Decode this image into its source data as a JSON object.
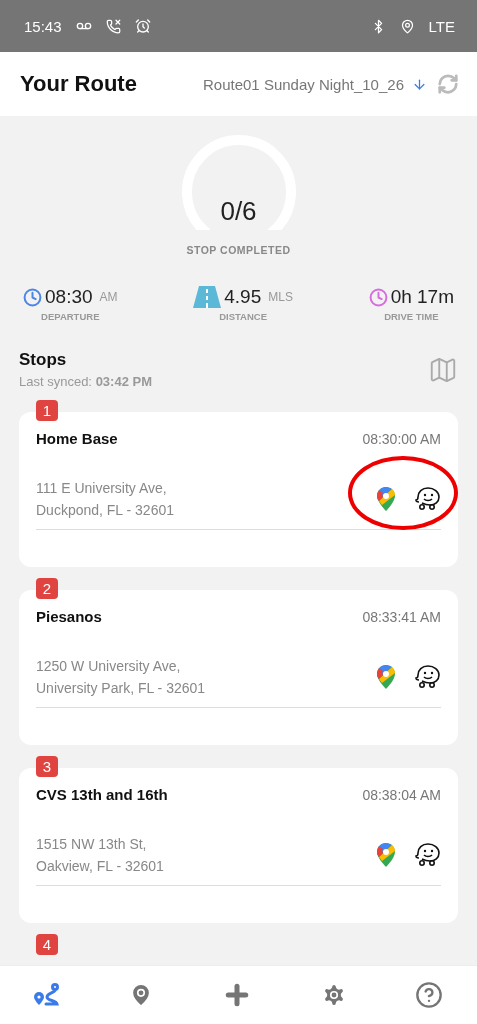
{
  "status_bar": {
    "time": "15:43",
    "network": "LTE"
  },
  "header": {
    "title": "Your Route",
    "route_name": "Route01 Sunday Night_10_26"
  },
  "progress": {
    "value": "0/6",
    "label": "STOP COMPLETED"
  },
  "stats": [
    {
      "kind": "clock",
      "value": "08:30",
      "unit": "AM",
      "label": "DEPARTURE",
      "color": "#4a86e8"
    },
    {
      "kind": "road",
      "value": "4.95",
      "unit": "MLS",
      "label": "DISTANCE",
      "color": "#5bb8d6"
    },
    {
      "kind": "clock",
      "value": "0h 17m",
      "label": "DRIVE TIME",
      "color": "#d96be0"
    }
  ],
  "stops_section": {
    "title": "Stops",
    "synced_label": "Last synced:",
    "synced_time": "03:42 PM"
  },
  "stops": [
    {
      "number": "1",
      "name": "Home Base",
      "time": "08:30:00 AM",
      "address": [
        "111 E University Ave,",
        "Duckpond, FL - 32601"
      ],
      "highlighted": true
    },
    {
      "number": "2",
      "name": "Piesanos",
      "time": "08:33:41 AM",
      "address": [
        "1250 W University Ave,",
        "University Park, FL - 32601"
      ],
      "highlighted": false
    },
    {
      "number": "3",
      "name": "CVS 13th and 16th",
      "time": "08:38:04 AM",
      "address": [
        "1515 NW 13th St,",
        "Oakview, FL - 32601"
      ],
      "highlighted": false
    },
    {
      "number": "4"
    }
  ],
  "nav": [
    {
      "kind": "route",
      "selected": true
    },
    {
      "kind": "pin",
      "selected": false
    },
    {
      "kind": "add",
      "selected": false
    },
    {
      "kind": "settings",
      "selected": false
    },
    {
      "kind": "help",
      "selected": false
    }
  ]
}
